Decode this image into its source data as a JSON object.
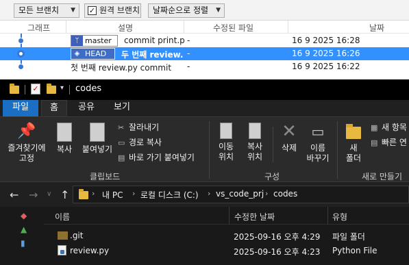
{
  "git": {
    "toolbar": {
      "branches_dropdown": "모든 브랜치",
      "remote_checkbox_label": "원격 브랜치",
      "remote_checked": true,
      "sort_dropdown": "날짜순으로 정렬"
    },
    "columns": {
      "graph": "그래프",
      "description": "설명",
      "modified_files": "수정된 파일",
      "date": "날짜"
    },
    "commits": [
      {
        "ref": "master",
        "ref_icon": "branch-icon",
        "message": "commit print.p",
        "files": "-",
        "date": "16 9 2025 16:28",
        "selected": false
      },
      {
        "ref": "HEAD",
        "ref_icon": "tag-icon",
        "message": "두 번째 review.",
        "files": "-",
        "date": "16 9 2025 16:26",
        "selected": true
      },
      {
        "ref": "",
        "message": "첫 번째 review.py commit",
        "files": "-",
        "date": "16 9 2025 16:22",
        "selected": false
      }
    ],
    "selection_color": "#3390ff"
  },
  "explorer": {
    "title": "codes",
    "tabs": [
      "파일",
      "홈",
      "공유",
      "보기"
    ],
    "active_tab": "홈",
    "ribbon": {
      "pin_quick_access": [
        "즐겨찾기에",
        "고정"
      ],
      "copy": "복사",
      "paste": "붙여넣기",
      "cut": "잘라내기",
      "copy_path": "경로 복사",
      "paste_shortcut": "바로 가기 붙여넣기",
      "clipboard_group": "클립보드",
      "move_to": [
        "이동",
        "위치"
      ],
      "copy_to": [
        "복사",
        "위치"
      ],
      "delete": "삭제",
      "rename": [
        "이름",
        "바꾸기"
      ],
      "organize_group": "구성",
      "new_folder": [
        "새",
        "폴더"
      ],
      "new_item": "새 항목",
      "easy_access": "빠른 연",
      "new_group": "새로 만들기"
    },
    "address": {
      "crumbs": [
        "내 PC",
        "로컬 디스크 (C:)",
        "vs_code_prj",
        "codes"
      ]
    },
    "file_columns": {
      "name": "이름",
      "modified": "수정한 날짜",
      "type": "유형"
    },
    "files": [
      {
        "name": ".git",
        "modified": "2025-09-16 오후 4:29",
        "type": "파일 폴더",
        "icon": "folder-icon"
      },
      {
        "name": "review.py",
        "modified": "2025-09-16 오후 4:23",
        "type": "Python File",
        "icon": "python-file-icon"
      }
    ],
    "accent": "#1a6fc4"
  }
}
